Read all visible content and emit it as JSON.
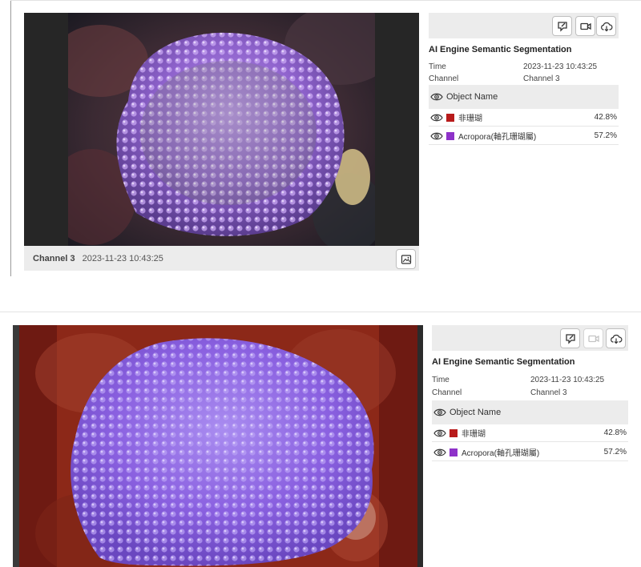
{
  "panels": [
    {
      "viewer": {
        "caption_channel": "Channel 3",
        "caption_time": "2023-11-23 10:43:25"
      },
      "info": {
        "title": "AI Engine Semantic Segmentation",
        "time_label": "Time",
        "time_value": "2023-11-23 10:43:25",
        "channel_label": "Channel",
        "channel_value": "Channel 3",
        "object_header": "Object Name",
        "objects": [
          {
            "name": "非珊瑚",
            "percent": "42.8%",
            "color": "#b81b1b"
          },
          {
            "name": "Acropora(軸孔珊瑚屬)",
            "percent": "57.2%",
            "color": "#8e32c9"
          }
        ]
      },
      "toolbar_icons": [
        "annotate-icon",
        "video-camera-icon",
        "cloud-download-icon"
      ]
    },
    {
      "info": {
        "title": "AI Engine Semantic Segmentation",
        "time_label": "Time",
        "time_value": "2023-11-23 10:43:25",
        "channel_label": "Channel",
        "channel_value": "Channel 3",
        "object_header": "Object Name",
        "objects": [
          {
            "name": "非珊瑚",
            "percent": "42.8%",
            "color": "#b81b1b"
          },
          {
            "name": "Acropora(軸孔珊瑚屬)",
            "percent": "57.2%",
            "color": "#8e32c9"
          }
        ]
      },
      "toolbar_icons": [
        "annotate-icon",
        "video-camera-icon",
        "cloud-download-icon"
      ]
    }
  ],
  "colors": {
    "non_coral": "#b81b1b",
    "acropora": "#8e32c9",
    "viewer_bg": "#262626",
    "panel_bg": "#ececec"
  }
}
